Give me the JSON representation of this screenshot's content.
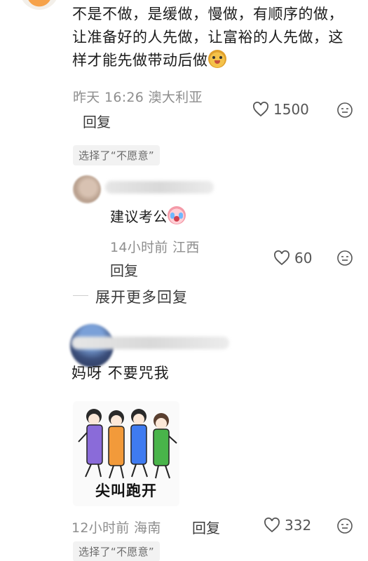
{
  "comment_top": {
    "text": "不是不做，是缓做，慢做，有顺序的做，让准备好的人先做，让富裕的人先做，这样才能先做带动后做",
    "emoji": "doge-emoji",
    "time": "昨天 16:26",
    "location": "澳大利亚",
    "reply_label": "回复",
    "likes": "1500",
    "choice": "选择了“不愿意”"
  },
  "sub_reply": {
    "text": "建议考公",
    "emoji": "crying-emoji",
    "time": "14小时前",
    "location": "江西",
    "reply_label": "回复",
    "likes": "60"
  },
  "expand_label": "展开更多回复",
  "comment_second": {
    "text": "妈呀 不要咒我",
    "sticker_caption": "尖叫跑开",
    "time": "12小时前",
    "location": "海南",
    "reply_label": "回复",
    "likes": "332",
    "choice": "选择了“不愿意”"
  },
  "colors": {
    "sticker_figures": [
      "#8a6bd9",
      "#f29a3a",
      "#3f7bf0",
      "#49b44a"
    ]
  }
}
